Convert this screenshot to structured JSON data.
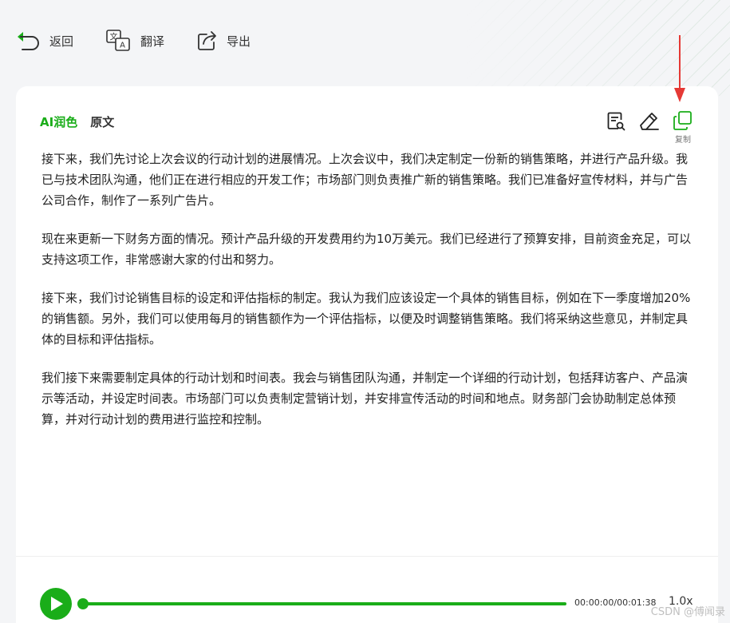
{
  "toolbar": {
    "back_label": "返回",
    "translate_label": "翻译",
    "export_label": "导出"
  },
  "tabs": {
    "ai_polish": "AI润色",
    "original": "原文"
  },
  "actions": {
    "copy_label": "复制"
  },
  "content": {
    "paragraphs": [
      "接下来，我们先讨论上次会议的行动计划的进展情况。上次会议中，我们决定制定一份新的销售策略，并进行产品升级。我已与技术团队沟通，他们正在进行相应的开发工作；市场部门则负责推广新的销售策略。我们已准备好宣传材料，并与广告公司合作，制作了一系列广告片。",
      "现在来更新一下财务方面的情况。预计产品升级的开发费用约为10万美元。我们已经进行了预算安排，目前资金充足，可以支持这项工作，非常感谢大家的付出和努力。",
      "接下来，我们讨论销售目标的设定和评估指标的制定。我认为我们应该设定一个具体的销售目标，例如在下一季度增加20%的销售额。另外，我们可以使用每月的销售额作为一个评估指标，以便及时调整销售策略。我们将采纳这些意见，并制定具体的目标和评估指标。",
      "我们接下来需要制定具体的行动计划和时间表。我会与销售团队沟通，并制定一个详细的行动计划，包括拜访客户、产品演示等活动，并设定时间表。市场部门可以负责制定营销计划，并安排宣传活动的时间和地点。财务部门会协助制定总体预算，并对行动计划的费用进行监控和控制。"
    ]
  },
  "player": {
    "time": "00:00:00/00:01:38",
    "speed": "1.0x",
    "progress": 0.0
  },
  "watermark": "CSDN @傅闻录",
  "colors": {
    "accent": "#1aad19",
    "annotation_arrow": "#e53935"
  }
}
